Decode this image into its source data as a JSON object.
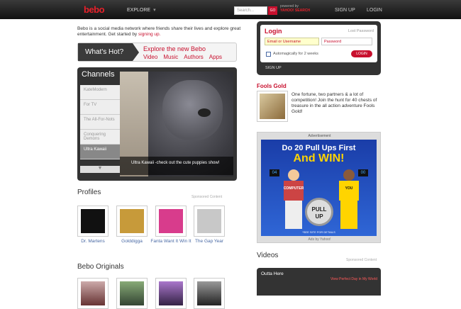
{
  "header": {
    "logo": "bebo",
    "explore": "EXPLORE",
    "search_placeholder": "Search...",
    "go": "GO",
    "powered_by": "powered by",
    "powered_brand": "YAHOO! SEARCH",
    "signup": "SIGN UP",
    "login": "LOGIN"
  },
  "intro": {
    "text": "Bebo is a social media network where friends share their lives and explore great entertainment. Get started by",
    "link": "signing up."
  },
  "whats_hot": {
    "label": "What's Hot?",
    "title": "Explore the new Bebo",
    "links": [
      "Video",
      "Music",
      "Authors",
      "Apps"
    ]
  },
  "channels": {
    "title": "Channels",
    "items": [
      "KateModern",
      "For TV",
      "The All-For-Nots",
      "Conquering Demons",
      "Ultra Kawaii"
    ],
    "active_index": 4,
    "caption": "Ultra Kawaii -check out the cute puppies show!"
  },
  "profiles": {
    "title": "Profiles",
    "sponsored": "Sponsored Content",
    "items": [
      {
        "label": "Dr. Martens",
        "color": "#111111"
      },
      {
        "label": "Golddigga",
        "color": "#c79a3a"
      },
      {
        "label": "Fanta Want It Win It",
        "color": "#d83c8c"
      },
      {
        "label": "The Gap Year",
        "color": "#c8c8c8"
      }
    ]
  },
  "originals": {
    "title": "Bebo Originals"
  },
  "login": {
    "title": "Login",
    "lost_password": "Lost Password",
    "email_placeholder": "Email or Username",
    "password_placeholder": "Password",
    "remember": "Automagically for 2 weeks",
    "button": "LOGIN",
    "signup": "SIGN UP"
  },
  "fools_gold": {
    "title": "Fools Gold",
    "text": "One fortune, two partners & a lot of competition! Join the hunt for 40 chests of treasure in the all action adventure Fools Gold!"
  },
  "ad": {
    "label": "Advertisement",
    "headline": "Do 20 Pull Ups First",
    "headline2": "And WIN!",
    "counter_left": "04",
    "counter_right": "00",
    "left_tag": "COMPUTER",
    "right_tag": "YOU",
    "button": "PULL UP",
    "footer": "*SEE SITE FOR DETAILS",
    "by": "Ads by Yahoo!"
  },
  "videos": {
    "title": "Videos",
    "sponsored": "Sponsored Content",
    "item_title": "Outta Here",
    "item_link": "View Perfect Day in My World"
  }
}
